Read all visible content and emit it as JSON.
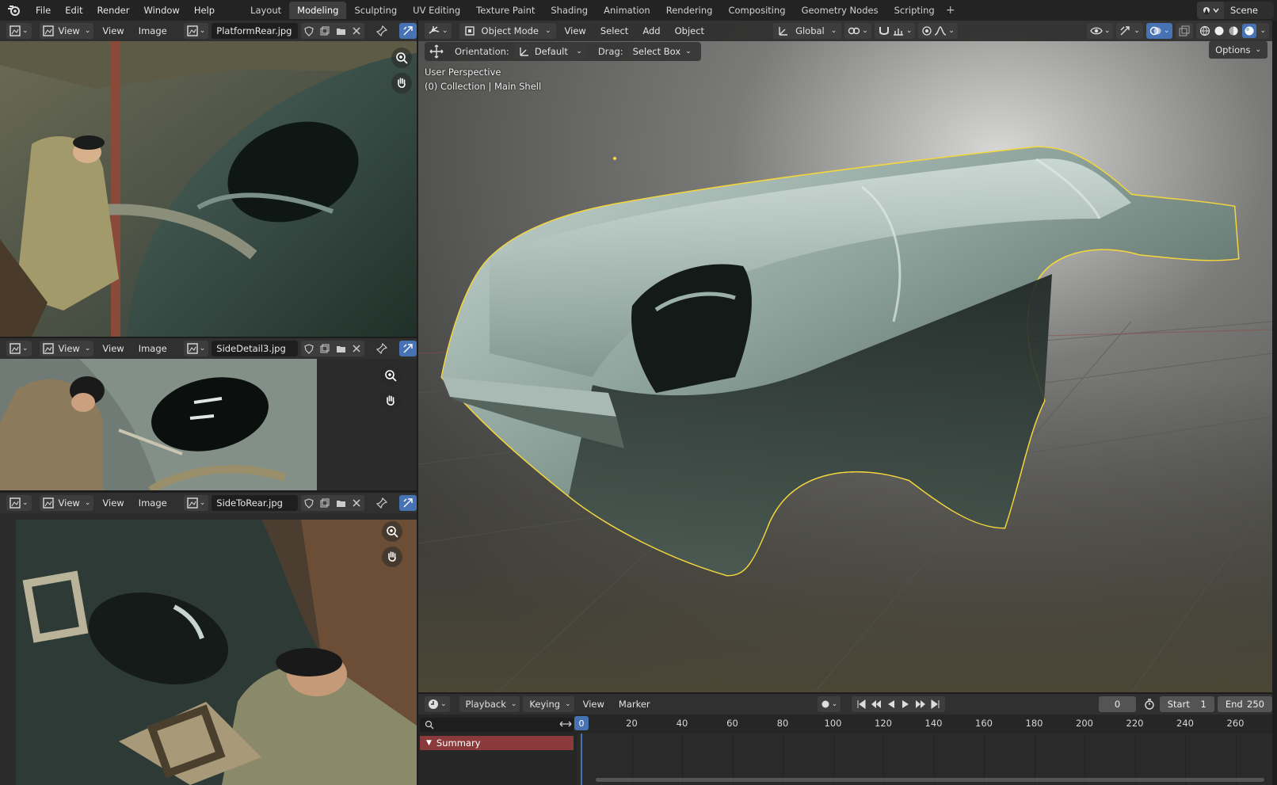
{
  "menubar": {
    "menus": [
      "File",
      "Edit",
      "Render",
      "Window",
      "Help"
    ],
    "workspaces": [
      "Layout",
      "Modeling",
      "Sculpting",
      "UV Editing",
      "Texture Paint",
      "Shading",
      "Animation",
      "Rendering",
      "Compositing",
      "Geometry Nodes",
      "Scripting"
    ],
    "active_workspace": "Modeling",
    "scene": "Scene"
  },
  "image_editors": [
    {
      "view": "View",
      "view2": "View",
      "image_menu": "Image",
      "filename": "PlatformRear.jpg"
    },
    {
      "view": "View",
      "view2": "View",
      "image_menu": "Image",
      "filename": "SideDetail3.jpg"
    },
    {
      "view": "View",
      "view2": "View",
      "image_menu": "Image",
      "filename": "SideToRear.jpg"
    }
  ],
  "viewport": {
    "mode": "Object Mode",
    "menus": [
      "View",
      "Select",
      "Add",
      "Object"
    ],
    "transform_orientation": "Global",
    "orientation_label": "Orientation:",
    "orientation_value": "Default",
    "drag_label": "Drag:",
    "drag_value": "Select Box",
    "options": "Options",
    "info_line1": "User Perspective",
    "info_line2": "(0) Collection | Main Shell",
    "selection_color": "#f5d73a"
  },
  "timeline": {
    "menus": [
      "Playback",
      "Keying",
      "View",
      "Marker"
    ],
    "current_frame": "0",
    "start_label": "Start",
    "start_value": "1",
    "end_label": "End",
    "end_value": "250",
    "ruler_labels": [
      "0",
      "20",
      "40",
      "60",
      "80",
      "100",
      "120",
      "140",
      "160",
      "180",
      "200",
      "220",
      "240",
      "260"
    ],
    "summary": "Summary"
  },
  "colors": {
    "accent_blue": "#4772b3",
    "active_tab": "#3f3f3f",
    "summary_red": "#8a3a3a"
  }
}
